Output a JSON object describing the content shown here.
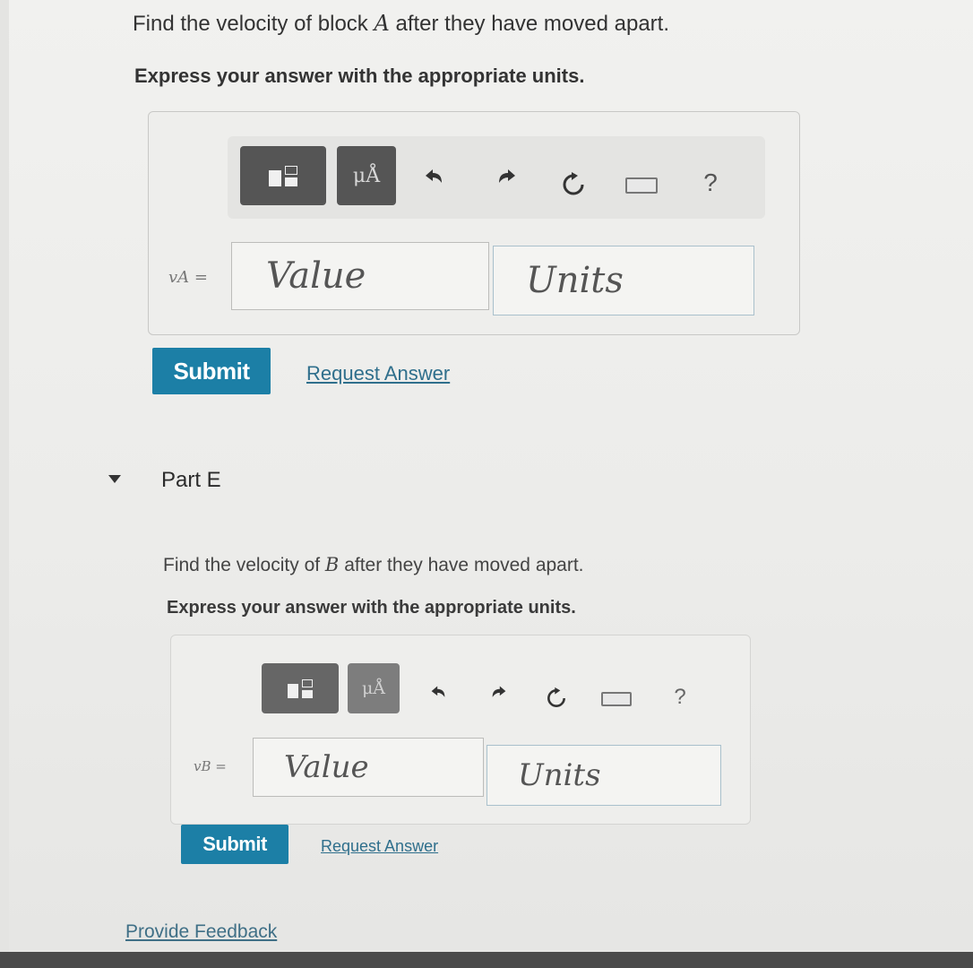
{
  "part_d": {
    "question_before": "Find the velocity of block ",
    "question_var": "A",
    "question_after": " after they have moved apart.",
    "instruction": "Express your answer with the appropriate units.",
    "variable_label": "vA =",
    "value_placeholder": "Value",
    "units_placeholder": "Units",
    "submit_label": "Submit",
    "request_answer_label": "Request Answer"
  },
  "part_e": {
    "title": "Part E",
    "question_before": "Find the velocity of ",
    "question_var": "B",
    "question_after": " after they have moved apart.",
    "instruction": "Express your answer with the appropriate units.",
    "variable_label": "vB =",
    "value_placeholder": "Value",
    "units_placeholder": "Units",
    "submit_label": "Submit",
    "request_answer_label": "Request Answer"
  },
  "toolbar": {
    "units_button_label": "μÅ",
    "help_label": "?",
    "icons": [
      "templates-icon",
      "units-icon",
      "undo-icon",
      "redo-icon",
      "reset-icon",
      "keyboard-icon",
      "help-icon"
    ]
  },
  "footer": {
    "feedback_label": "Provide Feedback"
  },
  "colors": {
    "submit": "#1c7fa6",
    "link": "#2f6f8c",
    "toolbar_button": "#555555"
  }
}
